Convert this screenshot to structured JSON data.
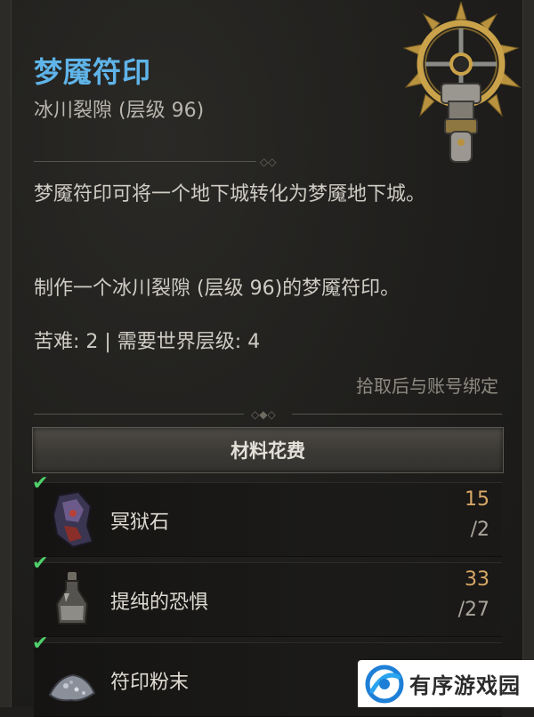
{
  "item": {
    "name": "梦魇符印",
    "subtitle": "冰川裂隙 (层级 96)",
    "description_1": "梦魇符印可将一个地下城转化为梦魇地下城。",
    "description_2": "制作一个冰川裂隙 (层级 96)的梦魇符印。",
    "difficulty_line": "苦难: 2 | 需要世界层级: 4",
    "bind_note": "拾取后与账号绑定"
  },
  "costs": {
    "header": "材料花费",
    "rows": [
      {
        "check": "✔",
        "name": "冥狱石",
        "have": "15",
        "need": "/2",
        "icon": "nether-stone-icon"
      },
      {
        "check": "✔",
        "name": "提纯的恐惧",
        "have": "33",
        "need": "/27",
        "icon": "distilled-fear-icon"
      },
      {
        "check": "✔",
        "name": "符印粉末",
        "have": "",
        "need": "",
        "icon": "sigil-powder-icon"
      }
    ]
  },
  "watermark": {
    "text": "有序游戏园",
    "icon": "logo-icon"
  },
  "colors": {
    "title": "#5fb4e8",
    "check": "#4fd06a",
    "count": "#d7a766",
    "background": "#1f1e1c"
  }
}
